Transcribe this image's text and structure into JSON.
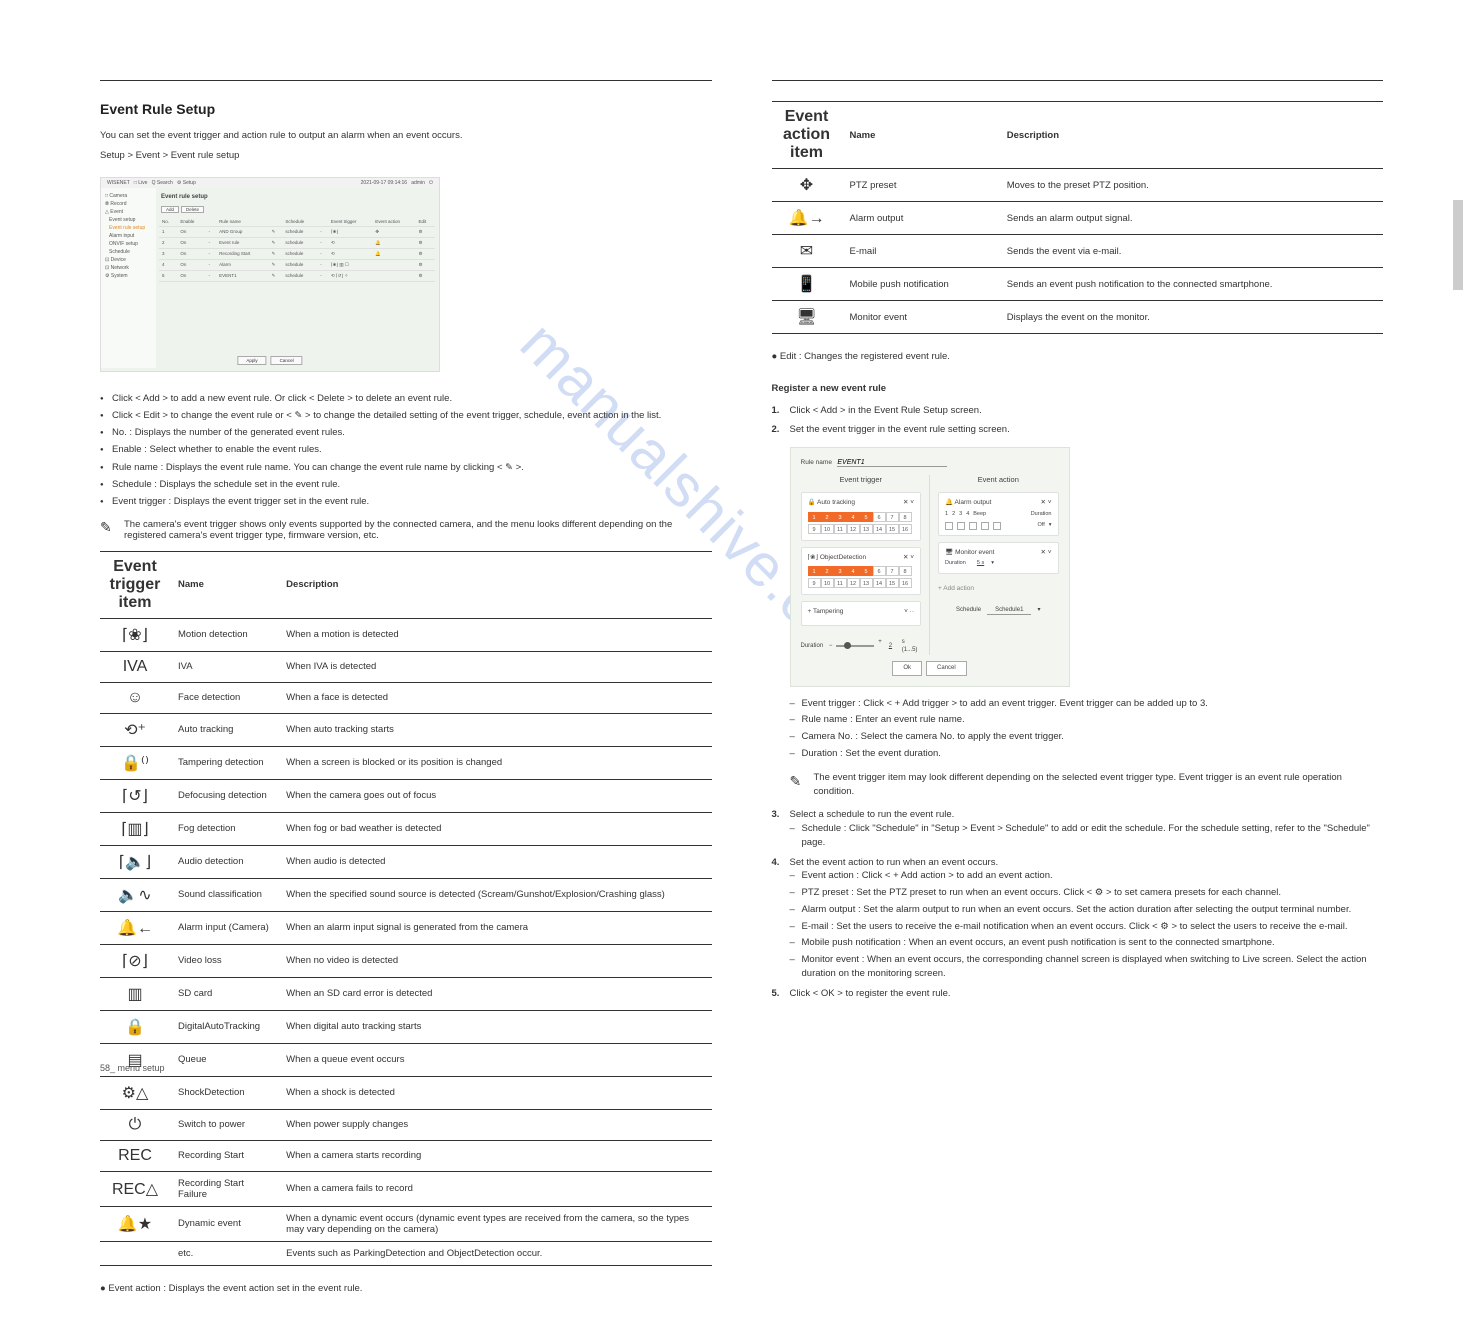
{
  "header": {
    "watermark": "manualshive.com"
  },
  "left": {
    "title": "Event Rule Setup",
    "intro": "You can set the event trigger and action rule to output an alarm when an event occurs.",
    "path_label": "Setup > Event > Event rule setup",
    "notes_heading_note": "",
    "notes": [
      "Click < Add > to add a new event rule. Or click < Delete > to delete an event rule.",
      "Click < Edit > to change the event rule or < ✎ > to change the detailed setting of the event trigger, schedule, event action in the list.",
      "No. : Displays the number of the generated event rules.",
      "Enable : Select whether to enable the event rules.",
      "Rule name : Displays the event rule name. You can change the event rule name by clicking < ✎ >.",
      "Schedule : Displays the schedule set in the event rule.",
      "Event trigger : Displays the event trigger set in the event rule."
    ],
    "pencil_note": "The camera's event trigger shows only events supported by the connected camera, and the menu looks different depending on the registered camera's event trigger type, firmware version, etc.",
    "trigger_table_title": "Event trigger item",
    "trigger_table": [
      {
        "icon": "⌈❀⌋",
        "name": "Motion detection",
        "desc": "When a motion is detected"
      },
      {
        "icon": "IVA",
        "name": "IVA",
        "desc": "When IVA is detected"
      },
      {
        "icon": "☺",
        "name": "Face detection",
        "desc": "When a face is detected"
      },
      {
        "icon": "⟲⁺",
        "name": "Auto tracking",
        "desc": "When auto tracking starts"
      },
      {
        "icon": "🔒⁽⁾",
        "name": "Tampering detection",
        "desc": "When a screen is blocked or its position is changed"
      },
      {
        "icon": "⌈↺⌋",
        "name": "Defocusing detection",
        "desc": "When the camera goes out of focus"
      },
      {
        "icon": "⌈▥⌋",
        "name": "Fog detection",
        "desc": "When fog or bad weather is detected"
      },
      {
        "icon": "⌈🔈⌋",
        "name": "Audio detection",
        "desc": "When audio is detected"
      },
      {
        "icon": "🔈∿",
        "name": "Sound classification",
        "desc": "When the specified sound source is detected (Scream/Gunshot/Explosion/Crashing glass)"
      },
      {
        "icon": "🔔←",
        "name": "Alarm input (Camera)",
        "desc": "When an alarm input signal is generated from the camera"
      },
      {
        "icon": "⌈⊘⌋",
        "name": "Video loss",
        "desc": "When no video is detected"
      },
      {
        "icon": "▥",
        "name": "SD card",
        "desc": "When an SD card error is detected"
      },
      {
        "icon": "🔒",
        "name": "DigitalAutoTracking",
        "desc": "When digital auto tracking starts"
      },
      {
        "icon": "▤",
        "name": "Queue",
        "desc": "When a queue event occurs"
      },
      {
        "icon": "⚙△",
        "name": "ShockDetection",
        "desc": "When a shock is detected"
      },
      {
        "icon": "⏻",
        "name": "Switch to power",
        "desc": "When power supply changes"
      },
      {
        "icon": "REC",
        "name": "Recording Start",
        "desc": "When a camera starts recording"
      },
      {
        "icon": "REC△",
        "name": "Recording Start Failure",
        "desc": "When a camera fails to record"
      },
      {
        "icon": "🔔★",
        "name": "Dynamic event",
        "desc": "When a dynamic event occurs (dynamic event types are received from the camera, so the types may vary depending on the camera)"
      },
      {
        "icon": "",
        "name": "etc.",
        "desc": "Events such as ParkingDetection and ObjectDetection occur."
      }
    ],
    "action_lead": "Event action : Displays the event action set in the event rule."
  },
  "right": {
    "action_table_title": "Event action item",
    "action_table": [
      {
        "icon": "✥",
        "name": "PTZ preset",
        "desc": "Moves to the preset PTZ position."
      },
      {
        "icon": "🔔→",
        "name": "Alarm output",
        "desc": "Sends an alarm output signal."
      },
      {
        "icon": "✉",
        "name": "E-mail",
        "desc": "Sends the event via e-mail."
      },
      {
        "icon": "📱",
        "name": "Mobile push notification",
        "desc": "Sends an event push notification to the connected smartphone."
      },
      {
        "icon": "🖥",
        "name": "Monitor event",
        "desc": "Displays the event on the monitor."
      }
    ],
    "action_note": "Edit : Changes the registered event rule.",
    "register_title": "Register a new event rule",
    "reg_steps_1": "Click < Add > in the Event Rule Setup screen.",
    "reg_steps_2": "Set the event trigger in the event rule setting screen.",
    "reg_sub": [
      "Event trigger : Click < + Add trigger > to add an event trigger. Event trigger can be added up to 3.",
      "Rule name : Enter an event rule name.",
      "Camera No. : Select the camera No. to apply the event trigger.",
      "Duration : Set the event duration."
    ],
    "reg_note": "The event trigger item may look different depending on the selected event trigger type. Event trigger is an event rule operation condition.",
    "reg_steps_3": "Select a schedule to run the event rule.",
    "reg_steps_3_sub": "Schedule : Click \"Schedule\" in \"Setup > Event > Schedule\" to add or edit the schedule. For the schedule setting, refer to the \"Schedule\" page.",
    "reg_steps_4": "Set the event action to run when an event occurs.",
    "reg_sub4": [
      "Event action : Click < + Add action > to add an event action.",
      "PTZ preset : Set the PTZ preset to run when an event occurs. Click < ⚙ > to set camera presets for each channel.",
      "Alarm output : Set the alarm output to run when an event occurs. Set the action duration after selecting the output terminal number.",
      "E-mail : Set the users to receive the e-mail notification when an event occurs. Click < ⚙ > to select the users to receive the e-mail.",
      "Mobile push notification : When an event occurs, an event push notification is sent to the connected smartphone.",
      "Monitor event : When an event occurs, the corresponding channel screen is displayed when switching to Live screen. Select the action duration on the monitoring screen."
    ],
    "reg_steps_5": "Click < OK > to register the event rule.",
    "ui2": {
      "rule_name_label": "Rule name",
      "rule_name_val": "EVENT1",
      "et_title": "Event trigger",
      "ea_title": "Event action",
      "et1_title": "Auto tracking",
      "et2_title": "ObjectDetection",
      "ea1_title": "Alarm output",
      "ea1_row_labels": [
        "1",
        "2",
        "3",
        "4",
        "Beep",
        "Duration"
      ],
      "ea1_off": "Off",
      "ea2_title": "Monitor event",
      "ea2_dur_label": "Duration",
      "ea2_dur_val": "5 s",
      "addact": "+  Add action",
      "addtrig": "+ Tampering",
      "dur_label": "Duration",
      "dur_val": "2",
      "dur_unit": "s  (1...5)",
      "sched_label": "Schedule",
      "sched_val": "Schedule1",
      "ok": "Ok",
      "cancel": "Cancel",
      "chips_on": [
        1,
        2,
        3,
        4,
        5
      ],
      "chips_total": 16
    }
  },
  "footer": {
    "left": "58_ menu setup",
    "right": ""
  }
}
